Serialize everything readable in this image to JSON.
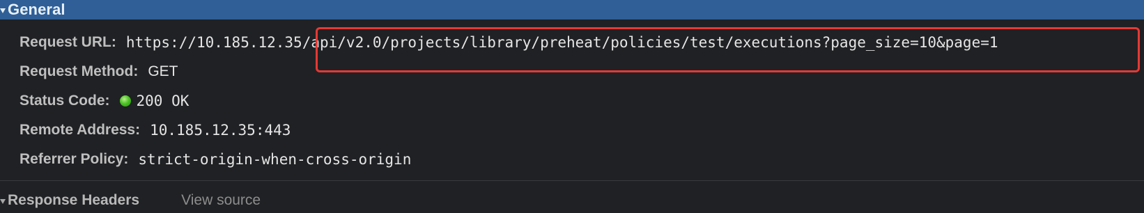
{
  "general": {
    "title": "General",
    "rows": [
      {
        "label": "Request URL:",
        "value": "https://10.185.12.35/api/v2.0/projects/library/preheat/policies/test/executions?page_size=10&page=1"
      },
      {
        "label": "Request Method:",
        "value": "GET"
      },
      {
        "label": "Status Code:",
        "value": "200 OK",
        "status_color": "#49c221"
      },
      {
        "label": "Remote Address:",
        "value": "10.185.12.35:443"
      },
      {
        "label": "Referrer Policy:",
        "value": "strict-origin-when-cross-origin"
      }
    ]
  },
  "response_headers": {
    "title": "Response Headers",
    "view_source": "View source"
  },
  "highlight": {
    "color": "#e53935"
  },
  "colors": {
    "header_bg": "#2f5f96",
    "page_bg": "#202124"
  }
}
